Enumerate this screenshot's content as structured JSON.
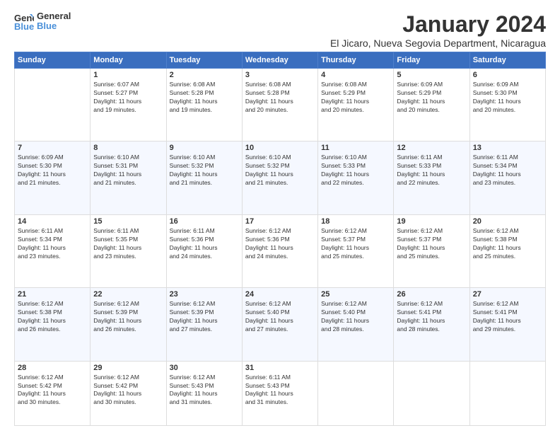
{
  "logo": {
    "text_general": "General",
    "text_blue": "Blue"
  },
  "header": {
    "month_title": "January 2024",
    "subtitle": "El Jicaro, Nueva Segovia Department, Nicaragua"
  },
  "days_of_week": [
    "Sunday",
    "Monday",
    "Tuesday",
    "Wednesday",
    "Thursday",
    "Friday",
    "Saturday"
  ],
  "weeks": [
    [
      {
        "day": "",
        "info": ""
      },
      {
        "day": "1",
        "info": "Sunrise: 6:07 AM\nSunset: 5:27 PM\nDaylight: 11 hours\nand 19 minutes."
      },
      {
        "day": "2",
        "info": "Sunrise: 6:08 AM\nSunset: 5:28 PM\nDaylight: 11 hours\nand 19 minutes."
      },
      {
        "day": "3",
        "info": "Sunrise: 6:08 AM\nSunset: 5:28 PM\nDaylight: 11 hours\nand 20 minutes."
      },
      {
        "day": "4",
        "info": "Sunrise: 6:08 AM\nSunset: 5:29 PM\nDaylight: 11 hours\nand 20 minutes."
      },
      {
        "day": "5",
        "info": "Sunrise: 6:09 AM\nSunset: 5:29 PM\nDaylight: 11 hours\nand 20 minutes."
      },
      {
        "day": "6",
        "info": "Sunrise: 6:09 AM\nSunset: 5:30 PM\nDaylight: 11 hours\nand 20 minutes."
      }
    ],
    [
      {
        "day": "7",
        "info": "Sunrise: 6:09 AM\nSunset: 5:30 PM\nDaylight: 11 hours\nand 21 minutes."
      },
      {
        "day": "8",
        "info": "Sunrise: 6:10 AM\nSunset: 5:31 PM\nDaylight: 11 hours\nand 21 minutes."
      },
      {
        "day": "9",
        "info": "Sunrise: 6:10 AM\nSunset: 5:32 PM\nDaylight: 11 hours\nand 21 minutes."
      },
      {
        "day": "10",
        "info": "Sunrise: 6:10 AM\nSunset: 5:32 PM\nDaylight: 11 hours\nand 21 minutes."
      },
      {
        "day": "11",
        "info": "Sunrise: 6:10 AM\nSunset: 5:33 PM\nDaylight: 11 hours\nand 22 minutes."
      },
      {
        "day": "12",
        "info": "Sunrise: 6:11 AM\nSunset: 5:33 PM\nDaylight: 11 hours\nand 22 minutes."
      },
      {
        "day": "13",
        "info": "Sunrise: 6:11 AM\nSunset: 5:34 PM\nDaylight: 11 hours\nand 23 minutes."
      }
    ],
    [
      {
        "day": "14",
        "info": "Sunrise: 6:11 AM\nSunset: 5:34 PM\nDaylight: 11 hours\nand 23 minutes."
      },
      {
        "day": "15",
        "info": "Sunrise: 6:11 AM\nSunset: 5:35 PM\nDaylight: 11 hours\nand 23 minutes."
      },
      {
        "day": "16",
        "info": "Sunrise: 6:11 AM\nSunset: 5:36 PM\nDaylight: 11 hours\nand 24 minutes."
      },
      {
        "day": "17",
        "info": "Sunrise: 6:12 AM\nSunset: 5:36 PM\nDaylight: 11 hours\nand 24 minutes."
      },
      {
        "day": "18",
        "info": "Sunrise: 6:12 AM\nSunset: 5:37 PM\nDaylight: 11 hours\nand 25 minutes."
      },
      {
        "day": "19",
        "info": "Sunrise: 6:12 AM\nSunset: 5:37 PM\nDaylight: 11 hours\nand 25 minutes."
      },
      {
        "day": "20",
        "info": "Sunrise: 6:12 AM\nSunset: 5:38 PM\nDaylight: 11 hours\nand 25 minutes."
      }
    ],
    [
      {
        "day": "21",
        "info": "Sunrise: 6:12 AM\nSunset: 5:38 PM\nDaylight: 11 hours\nand 26 minutes."
      },
      {
        "day": "22",
        "info": "Sunrise: 6:12 AM\nSunset: 5:39 PM\nDaylight: 11 hours\nand 26 minutes."
      },
      {
        "day": "23",
        "info": "Sunrise: 6:12 AM\nSunset: 5:39 PM\nDaylight: 11 hours\nand 27 minutes."
      },
      {
        "day": "24",
        "info": "Sunrise: 6:12 AM\nSunset: 5:40 PM\nDaylight: 11 hours\nand 27 minutes."
      },
      {
        "day": "25",
        "info": "Sunrise: 6:12 AM\nSunset: 5:40 PM\nDaylight: 11 hours\nand 28 minutes."
      },
      {
        "day": "26",
        "info": "Sunrise: 6:12 AM\nSunset: 5:41 PM\nDaylight: 11 hours\nand 28 minutes."
      },
      {
        "day": "27",
        "info": "Sunrise: 6:12 AM\nSunset: 5:41 PM\nDaylight: 11 hours\nand 29 minutes."
      }
    ],
    [
      {
        "day": "28",
        "info": "Sunrise: 6:12 AM\nSunset: 5:42 PM\nDaylight: 11 hours\nand 30 minutes."
      },
      {
        "day": "29",
        "info": "Sunrise: 6:12 AM\nSunset: 5:42 PM\nDaylight: 11 hours\nand 30 minutes."
      },
      {
        "day": "30",
        "info": "Sunrise: 6:12 AM\nSunset: 5:43 PM\nDaylight: 11 hours\nand 31 minutes."
      },
      {
        "day": "31",
        "info": "Sunrise: 6:11 AM\nSunset: 5:43 PM\nDaylight: 11 hours\nand 31 minutes."
      },
      {
        "day": "",
        "info": ""
      },
      {
        "day": "",
        "info": ""
      },
      {
        "day": "",
        "info": ""
      }
    ]
  ]
}
